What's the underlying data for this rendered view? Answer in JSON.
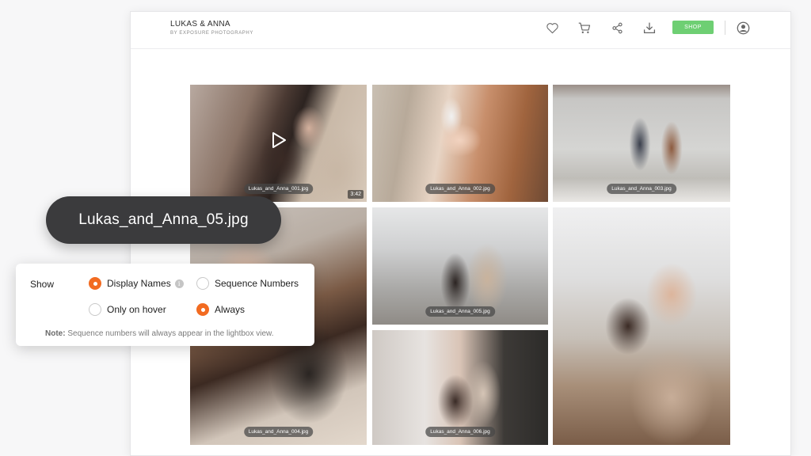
{
  "header": {
    "title": "LUKAS & ANNA",
    "subtitle": "BY EXPOSURE PHOTOGRAPHY",
    "shop_label": "SHOP",
    "icons": [
      "heart-icon",
      "cart-icon",
      "share-icon",
      "download-icon",
      "account-icon"
    ]
  },
  "gallery": {
    "photos": [
      {
        "caption": "Lukas_and_Anna_001.jpg",
        "duration": "3:42",
        "type": "video"
      },
      {
        "caption": "Lukas_and_Anna_002.jpg",
        "type": "image"
      },
      {
        "caption": "Lukas_and_Anna_003.jpg",
        "type": "image"
      },
      {
        "caption": "Lukas_and_Anna_004.jpg",
        "type": "image"
      },
      {
        "caption": "Lukas_and_Anna_005.jpg",
        "type": "image"
      },
      {
        "caption": "Lukas_and_Anna_006.jpg",
        "type": "image"
      },
      {
        "caption": "",
        "type": "image"
      }
    ]
  },
  "tooltip": {
    "filename": "Lukas_and_Anna_05.jpg"
  },
  "settings": {
    "show_label": "Show",
    "options": {
      "display_names": "Display Names",
      "sequence_numbers": "Sequence Numbers",
      "only_on_hover": "Only on hover",
      "always": "Always"
    },
    "selected": [
      "Display Names",
      "Always"
    ],
    "note_label": "Note:",
    "note_text": "Sequence numbers will always appear in the lightbox view."
  },
  "colors": {
    "accent": "#f26b21",
    "shop_button": "#6ecf73",
    "tooltip_bg": "#3b3b3d"
  }
}
